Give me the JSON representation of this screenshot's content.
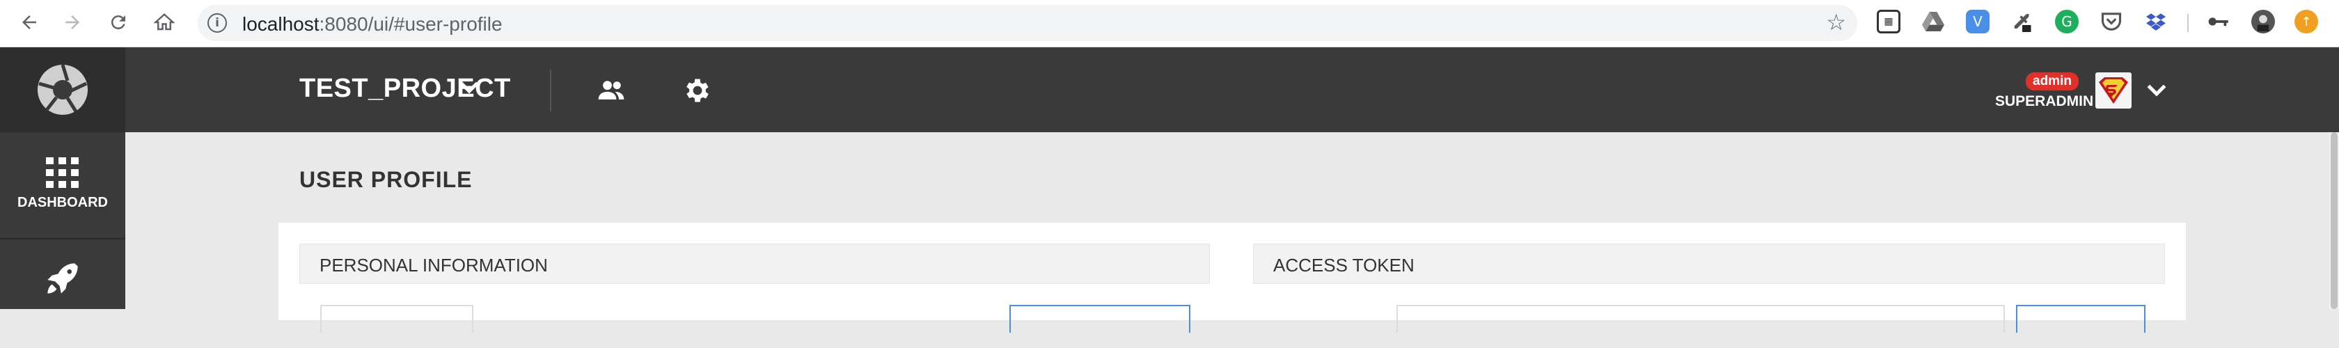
{
  "browser": {
    "url_host": "localhost",
    "url_rest": ":8080/ui/#user-profile"
  },
  "header": {
    "project": "TEST_PROJECT",
    "badge": "admin",
    "username": "SUPERADMIN"
  },
  "sidebar": {
    "items": [
      {
        "label": "DASHBOARD",
        "icon": "grid-icon"
      },
      {
        "label": "",
        "icon": "rocket-icon"
      }
    ]
  },
  "main": {
    "title": "USER PROFILE",
    "panels": [
      {
        "title": "PERSONAL INFORMATION"
      },
      {
        "title": "ACCESS TOKEN"
      }
    ]
  },
  "colors": {
    "header_bg": "#3a3a3a",
    "badge_red": "#e0302a",
    "accent_blue": "#4a90d9"
  }
}
